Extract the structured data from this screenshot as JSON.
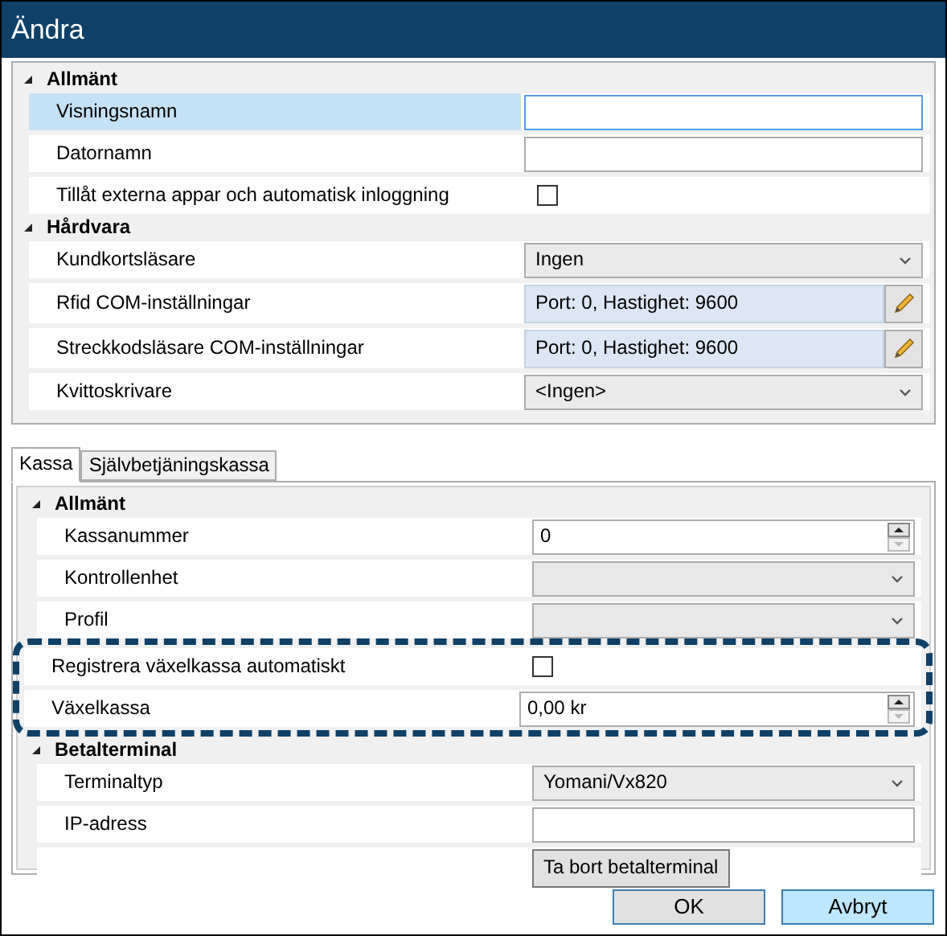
{
  "window": {
    "title": "Ändra"
  },
  "upper_grid": {
    "categories": [
      {
        "title": "Allmänt",
        "expanded": true,
        "rows": [
          {
            "label": "Visningsnamn",
            "kind": "text",
            "value": "",
            "selected": true,
            "focused": true
          },
          {
            "label": "Datornamn",
            "kind": "text",
            "value": "",
            "selected": false,
            "focused": false
          },
          {
            "label": "Tillåt externa appar och automatisk inloggning",
            "kind": "checkbox",
            "checked": false,
            "selected": false
          }
        ]
      },
      {
        "title": "Hårdvara",
        "expanded": true,
        "rows": [
          {
            "label": "Kundkortsläsare",
            "kind": "dropdown",
            "value": "Ingen",
            "disabled": false,
            "selected": false
          },
          {
            "label": "Rfid COM-inställningar",
            "kind": "editor",
            "value": "Port: 0, Hastighet: 9600",
            "selected": false
          },
          {
            "label": "Streckkodsläsare COM-inställningar",
            "kind": "editor",
            "value": "Port: 0, Hastighet: 9600",
            "selected": false
          },
          {
            "label": "Kvittoskrivare",
            "kind": "dropdown",
            "value": "<Ingen>",
            "disabled": false,
            "selected": false
          }
        ]
      }
    ]
  },
  "tabs": [
    {
      "label": "Kassa",
      "selected": true
    },
    {
      "label": "Självbetjäningskassa",
      "selected": false
    }
  ],
  "lower_grid": {
    "categories": [
      {
        "title": "Allmänt",
        "expanded": true,
        "rows": [
          {
            "label": "Kassanummer",
            "kind": "spin",
            "value": "0",
            "selected": false,
            "highlighted": false
          },
          {
            "label": "Kontrollenhet",
            "kind": "dropdown",
            "value": "",
            "disabled": true,
            "selected": false,
            "highlighted": false
          },
          {
            "label": "Profil",
            "kind": "dropdown",
            "value": "",
            "disabled": true,
            "selected": false,
            "highlighted": false
          },
          {
            "label": "Registrera växelkassa automatiskt",
            "kind": "checkbox",
            "checked": false,
            "selected": false,
            "highlighted": true
          },
          {
            "label": "Växelkassa",
            "kind": "spin",
            "value": "0,00 kr",
            "selected": false,
            "highlighted": true
          }
        ]
      },
      {
        "title": "Betalterminal",
        "expanded": true,
        "rows": [
          {
            "label": "Terminaltyp",
            "kind": "dropdown",
            "value": "Yomani/Vx820",
            "disabled": false,
            "selected": false,
            "highlighted": false
          },
          {
            "label": "IP-adress",
            "kind": "text",
            "value": "",
            "selected": false,
            "focused": false,
            "highlighted": false
          },
          {
            "label": "",
            "kind": "button",
            "value": "Ta bort betalterminal",
            "selected": false,
            "highlighted": false
          }
        ]
      }
    ]
  },
  "buttons": [
    {
      "label": "OK",
      "hovered": false
    },
    {
      "label": "Avbryt",
      "hovered": true
    }
  ]
}
